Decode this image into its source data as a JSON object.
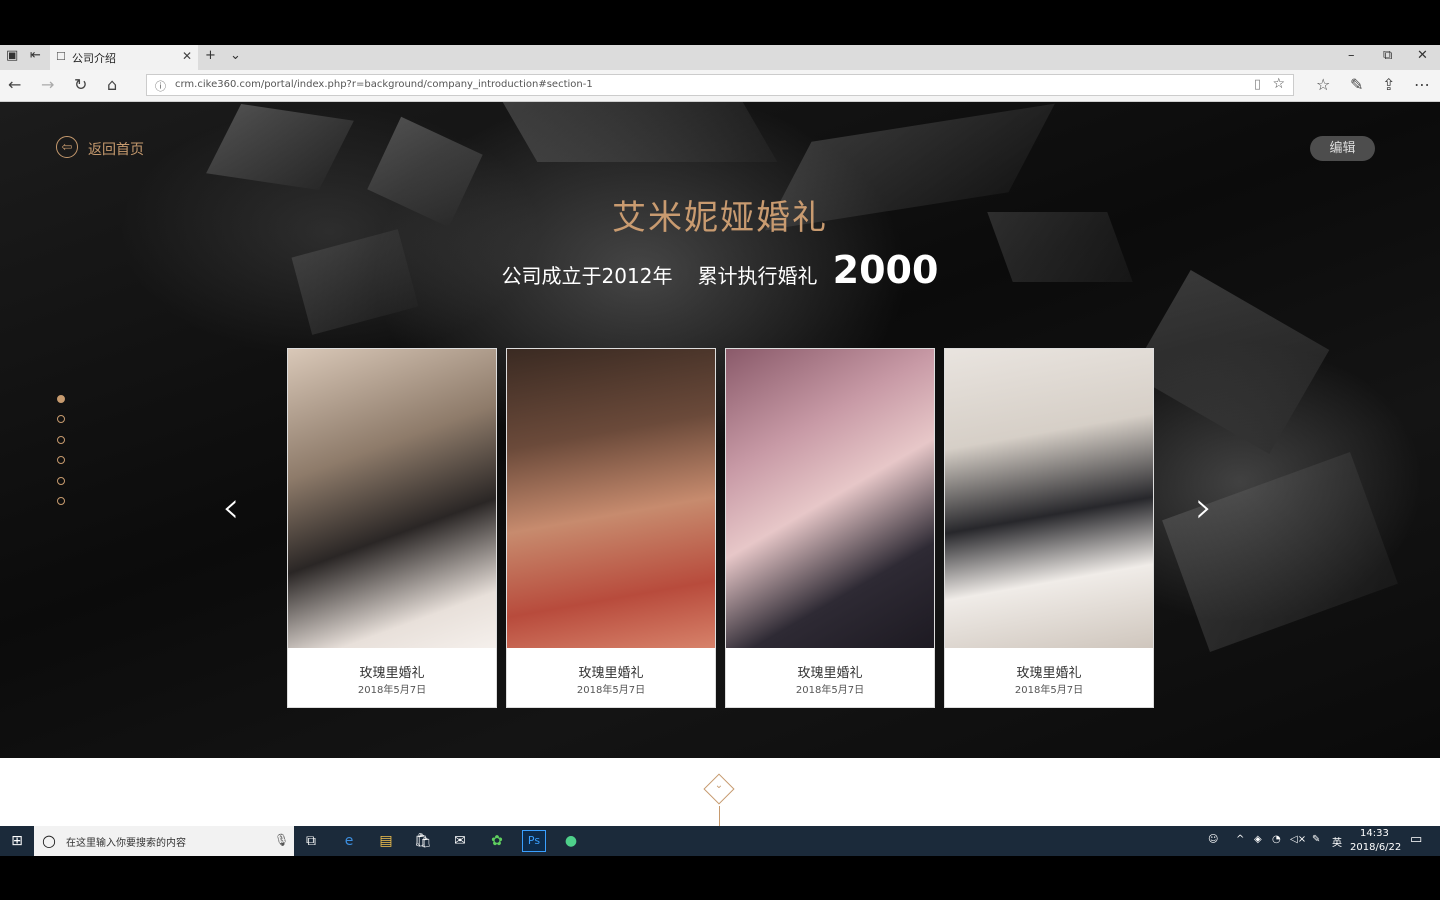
{
  "browser": {
    "tab_title": "公司介绍",
    "url": "crm.cike360.com/portal/index.php?r=background/company_introduction#section-1"
  },
  "page": {
    "back_label": "返回首页",
    "edit_label": "编辑",
    "brand": "艾米妮娅婚礼",
    "founded": "公司成立于2012年",
    "executed_label": "累计执行婚礼",
    "executed_count": "2000",
    "cards": [
      {
        "title": "玫瑰里婚礼",
        "date": "2018年5月7日"
      },
      {
        "title": "玫瑰里婚礼",
        "date": "2018年5月7日"
      },
      {
        "title": "玫瑰里婚礼",
        "date": "2018年5月7日"
      },
      {
        "title": "玫瑰里婚礼",
        "date": "2018年5月7日"
      }
    ],
    "accent_color": "#c69a6e"
  },
  "taskbar": {
    "search_placeholder": "在这里输入你要搜索的内容",
    "ime": "英",
    "time": "14:33",
    "date": "2018/6/22"
  }
}
